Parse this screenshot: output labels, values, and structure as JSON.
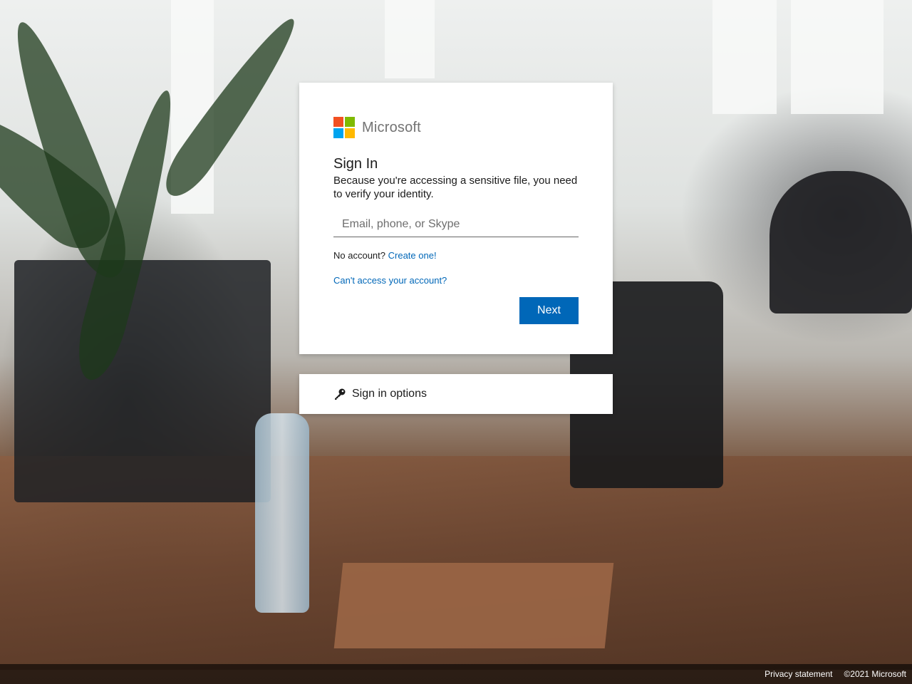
{
  "brand": {
    "name": "Microsoft",
    "logo_colors": [
      "#f25022",
      "#7fba00",
      "#00a4ef",
      "#ffb900"
    ]
  },
  "signin": {
    "title": "Sign In",
    "subtitle": "Because you're accessing a sensitive file, you need to verify your identity.",
    "email_placeholder": "Email, phone, or Skype",
    "email_value": "",
    "no_account_text": "No account?",
    "create_link": "Create one!",
    "cant_access_link": "Can't access your account?",
    "next_button": "Next"
  },
  "options": {
    "label": "Sign in options",
    "icon": "key-icon"
  },
  "footer": {
    "privacy": "Privacy statement",
    "copyright": "©2021 Microsoft"
  },
  "colors": {
    "accent": "#0067b8",
    "footer_bg": "rgba(0,0,0,0.6)"
  }
}
